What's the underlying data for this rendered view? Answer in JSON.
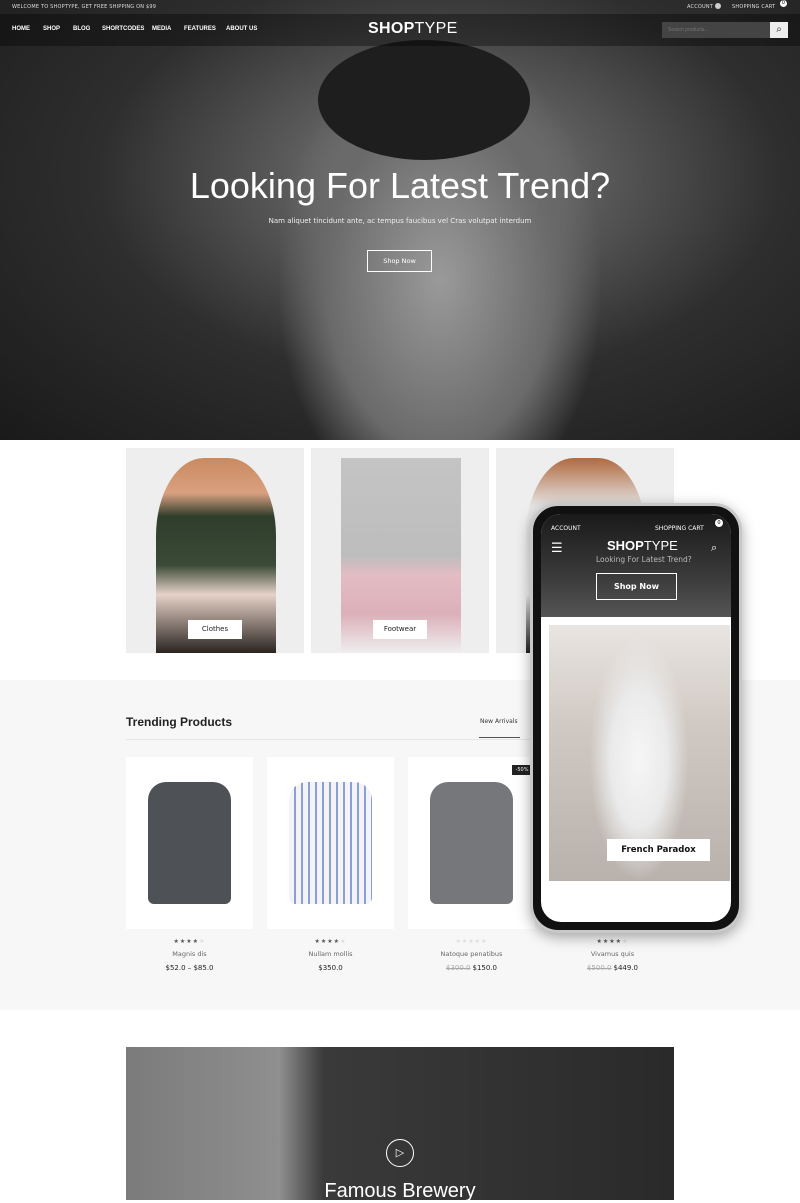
{
  "topbar": {
    "welcome": "WELCOME TO SHOPTYPE, GET FREE SHIPPING ON $99",
    "account": "ACCOUNT",
    "cart": "SHOPPING CART",
    "cart_count": "0"
  },
  "nav": {
    "items": [
      "HOME",
      "SHOP",
      "BLOG",
      "SHORTCODES",
      "MEDIA",
      "FEATURES",
      "ABOUT US"
    ]
  },
  "logo": {
    "bold": "SHOP",
    "light": "TYPE"
  },
  "search": {
    "placeholder": "Search products..."
  },
  "hero": {
    "title": "Looking For Latest Trend?",
    "subtitle": "Nam aliquet tincidunt ante, ac tempus faucibus vel Cras volutpat interdum",
    "button": "Shop Now"
  },
  "categories": [
    {
      "label": "Clothes"
    },
    {
      "label": "Footwear"
    },
    {
      "label": ""
    }
  ],
  "trending": {
    "title": "Trending Products",
    "tab": "New Arrivals",
    "badge": "-50%",
    "products": [
      {
        "name": "Magnis dis",
        "price": "$52.0 – $85.0",
        "old_price": "",
        "rating": 4
      },
      {
        "name": "Nullam mollis",
        "price": "$350.0",
        "old_price": "",
        "rating": 4
      },
      {
        "name": "Natoque penatibus",
        "price": "$150.0",
        "old_price": "$300.0",
        "rating": 0
      },
      {
        "name": "Vivamus quis",
        "price": "$449.0",
        "old_price": "$500.0",
        "rating": 4
      }
    ]
  },
  "banner": {
    "title": "Famous Brewery"
  },
  "phone": {
    "account": "ACCOUNT",
    "cart": "SHOPPING CART",
    "cart_count": "0",
    "logo_bold": "SHOP",
    "logo_light": "TYPE",
    "hero_title": "Looking For Latest Trend?",
    "button": "Shop Now",
    "card_label": "French Paradox"
  },
  "colors": {
    "dark": "#111111",
    "section_bg": "#f7f7f7",
    "text": "#222222"
  }
}
